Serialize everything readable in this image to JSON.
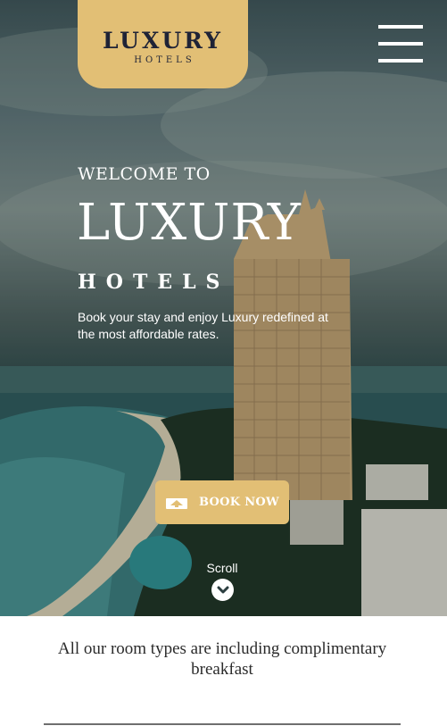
{
  "header": {
    "logo_title": "LUXURY",
    "logo_subtitle": "HOTELS",
    "menu_icon": "hamburger-menu-icon"
  },
  "hero": {
    "welcome": "WELCOME TO",
    "title": "LUXURY",
    "subtitle": "HOTELS",
    "description": "Book your stay and enjoy Luxury redefined at the most affordable rates.",
    "book_button": {
      "label": "BOOK NOW",
      "icon": "hotel-icon"
    },
    "scroll": {
      "label": "Scroll",
      "icon": "chevron-down-icon"
    }
  },
  "info": {
    "notice": "All our room types are including complimentary breakfast"
  },
  "colors": {
    "accent": "#e2bf75",
    "logo_text": "#1f2336",
    "hero_text": "#ffffff",
    "body_text": "#2b2b2b"
  }
}
